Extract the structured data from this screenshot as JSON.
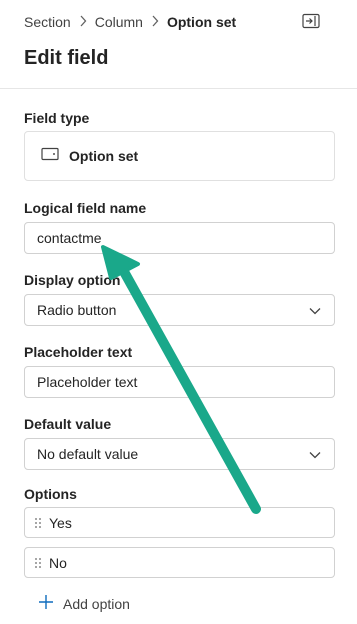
{
  "breadcrumb": {
    "items": [
      "Section",
      "Column",
      "Option set"
    ]
  },
  "header": {
    "title": "Edit field"
  },
  "field_type": {
    "label": "Field type",
    "value": "Option set"
  },
  "logical_name": {
    "label": "Logical field name",
    "value": "contactme"
  },
  "display_option": {
    "label": "Display option",
    "value": "Radio button"
  },
  "placeholder_text": {
    "label": "Placeholder text",
    "value": "Placeholder text"
  },
  "default_value": {
    "label": "Default value",
    "value": "No default value"
  },
  "options": {
    "label": "Options",
    "items": [
      "Yes",
      "No"
    ],
    "add_label": "Add option"
  },
  "colors": {
    "annotation_arrow": "#1aa88a",
    "accent": "#0f6cbd"
  }
}
